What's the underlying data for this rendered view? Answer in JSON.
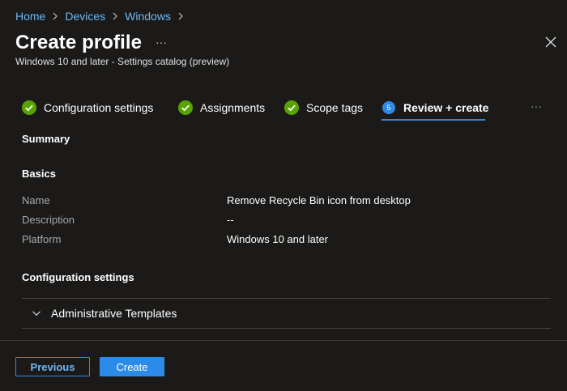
{
  "breadcrumb": {
    "items": [
      "Home",
      "Devices",
      "Windows"
    ]
  },
  "header": {
    "title": "Create profile",
    "more_label": "···",
    "subtitle": "Windows 10 and later - Settings catalog (preview)"
  },
  "tabs": {
    "items": [
      {
        "label": "Configuration settings",
        "state": "completed"
      },
      {
        "label": "Assignments",
        "state": "completed"
      },
      {
        "label": "Scope tags",
        "state": "completed"
      },
      {
        "label": "Review + create",
        "state": "active",
        "step": "5"
      }
    ],
    "more_label": "···"
  },
  "summary": {
    "heading": "Summary",
    "basics_heading": "Basics",
    "fields": [
      {
        "label": "Name",
        "value": "Remove Recycle Bin icon from desktop"
      },
      {
        "label": "Description",
        "value": "--"
      },
      {
        "label": "Platform",
        "value": "Windows 10 and later"
      }
    ],
    "config_heading": "Configuration settings",
    "accordion_label": "Administrative Templates"
  },
  "footer": {
    "previous_label": "Previous",
    "create_label": "Create"
  },
  "colors": {
    "background": "#1b1a19",
    "accent": "#2c8be8",
    "link": "#6cb8f6",
    "success": "#57a300"
  },
  "icons": {
    "close": "close-icon",
    "check": "checkmark-circle-icon",
    "chevron": "chevron-down-icon",
    "separator": "chevron-right-icon"
  }
}
